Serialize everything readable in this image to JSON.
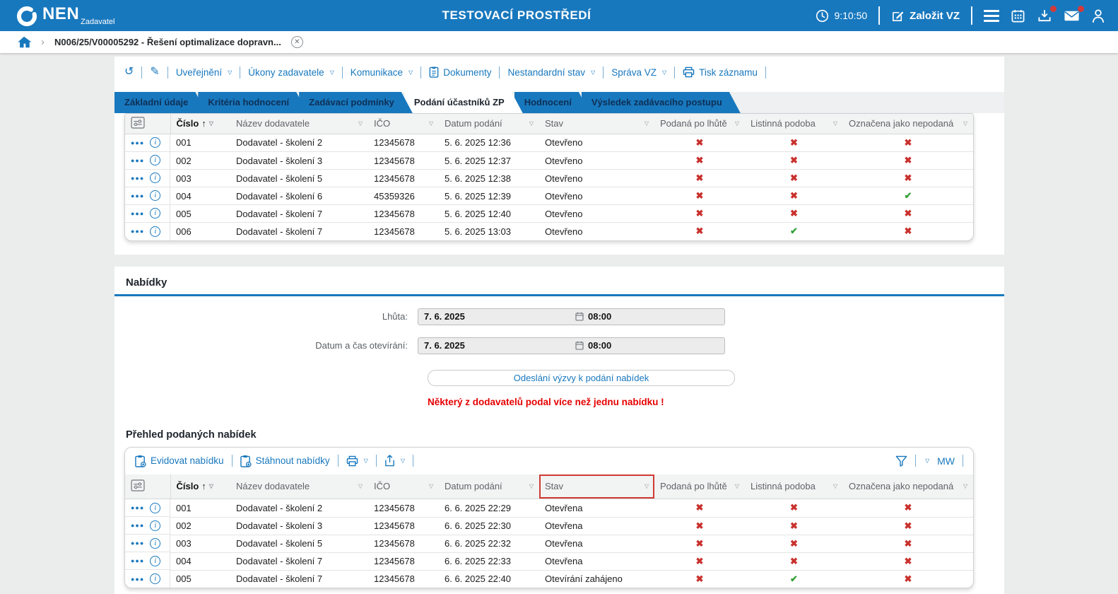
{
  "colors": {
    "accent": "#1878BE",
    "tab_text": "#0E2F55",
    "cross_red": "#C9302C",
    "check_green": "#35A139",
    "warning_red": "#E60000"
  },
  "icons": [
    "clock-icon",
    "compose-icon",
    "menu-icon",
    "calendar-icon",
    "inbox-icon",
    "mail-icon",
    "user-icon",
    "home-icon",
    "chevron-icon",
    "close-icon",
    "history-icon",
    "edit-icon",
    "document-icon",
    "print-icon",
    "share-icon",
    "filter-funnel-icon",
    "column-settings-icon",
    "row-menu-icon",
    "info-icon",
    "sort-asc-icon",
    "filter-caret-icon",
    "clipboard-add-icon",
    "clipboard-download-icon",
    "calendar-small-icon",
    "check-icon",
    "cross-icon"
  ],
  "header": {
    "logo_text": "NEN",
    "logo_sub": "Zadavatel",
    "env_title": "TESTOVACÍ PROSTŘEDÍ",
    "time": "9:10:50",
    "create_vz_label": "Založit VZ"
  },
  "breadcrumb": {
    "item": "N006/25/V00005292 - Řešení optimalizace dopravn..."
  },
  "toolbar": {
    "items": [
      "Uveřejnění",
      "Úkony zadavatele",
      "Komunikace",
      "Dokumenty",
      "Nestandardní stav",
      "Správa VZ",
      "Tisk záznamu"
    ]
  },
  "tabs": [
    {
      "label": "Základní údaje",
      "active": false
    },
    {
      "label": "Kritéria hodnocení",
      "active": false
    },
    {
      "label": "Zadávací podmínky",
      "active": false
    },
    {
      "label": "Podání účastníků ZP",
      "active": true
    },
    {
      "label": "Hodnocení",
      "active": false
    },
    {
      "label": "Výsledek zadávacího postupu",
      "active": false
    }
  ],
  "participants": {
    "columns": [
      "Číslo",
      "Název dodavatele",
      "IČO",
      "Datum podání",
      "Stav",
      "Podaná po lhůtě",
      "Listinná podoba",
      "Označena jako nepodaná"
    ],
    "rows": [
      {
        "cislo": "001",
        "nazev": "Dodavatel - školení 2",
        "ico": "12345678",
        "datum": "5. 6. 2025 12:36",
        "stav": "Otevřeno",
        "po_lhute": false,
        "listinna": false,
        "nepodana": false
      },
      {
        "cislo": "002",
        "nazev": "Dodavatel - školení 3",
        "ico": "12345678",
        "datum": "5. 6. 2025 12:37",
        "stav": "Otevřeno",
        "po_lhute": false,
        "listinna": false,
        "nepodana": false
      },
      {
        "cislo": "003",
        "nazev": "Dodavatel - školení 5",
        "ico": "12345678",
        "datum": "5. 6. 2025 12:38",
        "stav": "Otevřeno",
        "po_lhute": false,
        "listinna": false,
        "nepodana": false
      },
      {
        "cislo": "004",
        "nazev": "Dodavatel - školení 6",
        "ico": "45359326",
        "datum": "5. 6. 2025 12:39",
        "stav": "Otevřeno",
        "po_lhute": false,
        "listinna": false,
        "nepodana": true
      },
      {
        "cislo": "005",
        "nazev": "Dodavatel - školení 7",
        "ico": "12345678",
        "datum": "5. 6. 2025 12:40",
        "stav": "Otevřeno",
        "po_lhute": false,
        "listinna": false,
        "nepodana": false
      },
      {
        "cislo": "006",
        "nazev": "Dodavatel - školení 7",
        "ico": "12345678",
        "datum": "5. 6. 2025 13:03",
        "stav": "Otevřeno",
        "po_lhute": false,
        "listinna": true,
        "nepodana": false
      }
    ]
  },
  "nabidky": {
    "title": "Nabídky",
    "deadline_label": "Lhůta:",
    "deadline_date": "7. 6. 2025",
    "deadline_time": "08:00",
    "opening_label": "Datum a čas otevírání:",
    "opening_date": "7. 6. 2025",
    "opening_time": "08:00",
    "send_button_label": "Odeslání výzvy k podání nabídek",
    "warning": "Některý z dodavatelů podal více než jednu nabídku !"
  },
  "offers": {
    "title": "Přehled podaných nabídek",
    "toolbar": {
      "evidovat": "Evidovat nabídku",
      "stahnout": "Stáhnout nabídky",
      "mw": "MW"
    },
    "columns": [
      "Číslo",
      "Název dodavatele",
      "IČO",
      "Datum podání",
      "Stav",
      "Podaná po lhůtě",
      "Listinná podoba",
      "Označena jako nepodaná"
    ],
    "rows": [
      {
        "cislo": "001",
        "nazev": "Dodavatel - školení 2",
        "ico": "12345678",
        "datum": "6. 6. 2025 22:29",
        "stav": "Otevřena",
        "po_lhute": false,
        "listinna": false,
        "nepodana": false
      },
      {
        "cislo": "002",
        "nazev": "Dodavatel - školení 3",
        "ico": "12345678",
        "datum": "6. 6. 2025 22:30",
        "stav": "Otevřena",
        "po_lhute": false,
        "listinna": false,
        "nepodana": false
      },
      {
        "cislo": "003",
        "nazev": "Dodavatel - školení 5",
        "ico": "12345678",
        "datum": "6. 6. 2025 22:32",
        "stav": "Otevřena",
        "po_lhute": false,
        "listinna": false,
        "nepodana": false
      },
      {
        "cislo": "004",
        "nazev": "Dodavatel - školení 7",
        "ico": "12345678",
        "datum": "6. 6. 2025 22:33",
        "stav": "Otevřena",
        "po_lhute": false,
        "listinna": false,
        "nepodana": false
      },
      {
        "cislo": "005",
        "nazev": "Dodavatel - školení 7",
        "ico": "12345678",
        "datum": "6. 6. 2025 22:40",
        "stav": "Otevírání zahájeno",
        "po_lhute": false,
        "listinna": true,
        "nepodana": false
      }
    ]
  }
}
